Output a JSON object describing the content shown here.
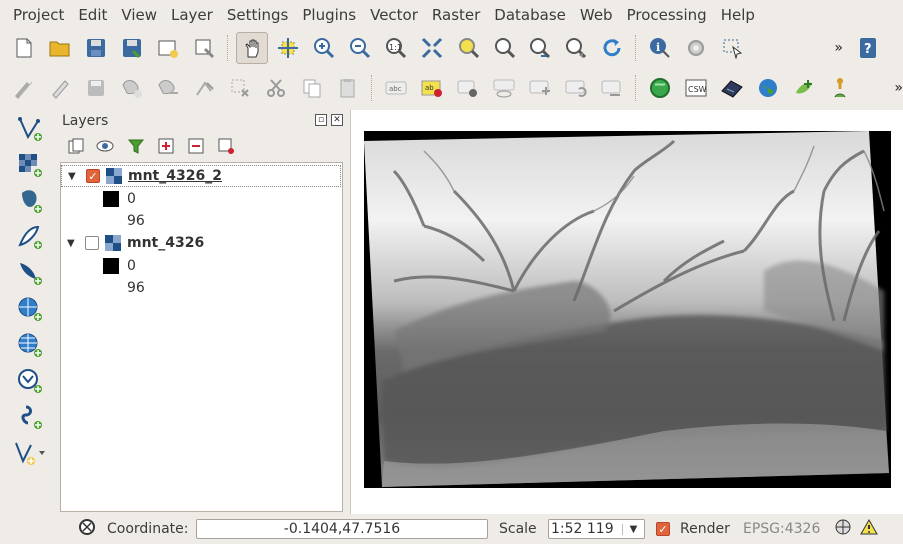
{
  "menu": [
    "Project",
    "Edit",
    "View",
    "Layer",
    "Settings",
    "Plugins",
    "Vector",
    "Raster",
    "Database",
    "Web",
    "Processing",
    "Help"
  ],
  "toolbar2_labels": {
    "csw": "CSW"
  },
  "layers_panel": {
    "title": "Layers",
    "layers": [
      {
        "name": "mnt_4326_2",
        "checked": true,
        "legend": [
          {
            "value": "0"
          },
          {
            "value": "96"
          }
        ]
      },
      {
        "name": "mnt_4326",
        "checked": false,
        "legend": [
          {
            "value": "0"
          },
          {
            "value": "96"
          }
        ]
      }
    ]
  },
  "status": {
    "coordinate_label": "Coordinate:",
    "coordinate_value": "-0.1404,47.7516",
    "scale_label": "Scale",
    "scale_value": "1:52 119",
    "render_label": "Render",
    "render_checked": true,
    "crs": "EPSG:4326"
  },
  "overflow_symbol": "»",
  "colors": {
    "accent": "#e0653d",
    "panel_bg": "#efebe7"
  }
}
